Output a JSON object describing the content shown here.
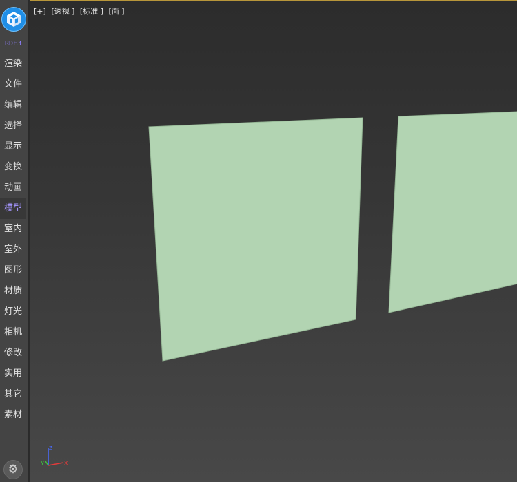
{
  "app": {
    "brand": "RDF3",
    "logo_icon": "cube-logo-icon",
    "settings_icon": "gear-icon"
  },
  "sidebar": {
    "items": [
      {
        "label": "渲染"
      },
      {
        "label": "文件"
      },
      {
        "label": "编辑"
      },
      {
        "label": "选择"
      },
      {
        "label": "显示"
      },
      {
        "label": "变换"
      },
      {
        "label": "动画"
      },
      {
        "label": "模型",
        "active": true
      },
      {
        "label": "室内"
      },
      {
        "label": "室外"
      },
      {
        "label": "图形"
      },
      {
        "label": "材质"
      },
      {
        "label": "灯光"
      },
      {
        "label": "相机"
      },
      {
        "label": "修改"
      },
      {
        "label": "实用"
      },
      {
        "label": "其它"
      },
      {
        "label": "素材"
      }
    ]
  },
  "viewport": {
    "labels": [
      "[+]",
      "[透视 ]",
      "[标准 ]",
      "[面 ]"
    ],
    "plane_color": "#b2d4b2",
    "active_border_color": "#b8963a",
    "axis": {
      "x": "x",
      "y": "y",
      "z": "z"
    }
  },
  "colors": {
    "sidebar_bg": "#444444",
    "accent": "#a596ff",
    "logo_blue": "#1f8ee6"
  }
}
